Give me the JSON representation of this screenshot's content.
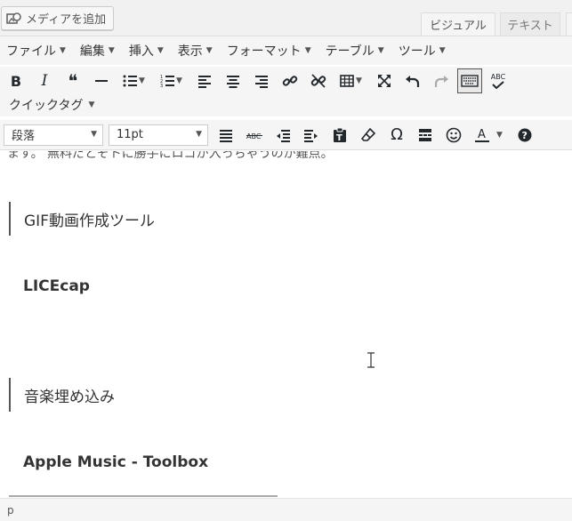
{
  "top": {
    "add_media_label": "メディアを追加",
    "tab_visual": "ビジュアル",
    "tab_text": "テキスト"
  },
  "menu": [
    {
      "label": "ファイル"
    },
    {
      "label": "編集"
    },
    {
      "label": "挿入"
    },
    {
      "label": "表示"
    },
    {
      "label": "フォーマット"
    },
    {
      "label": "テーブル"
    },
    {
      "label": "ツール"
    }
  ],
  "toolbar": {
    "bold": "B",
    "italic": "I",
    "quote": "❝",
    "quicktag": "クイックタグ",
    "format_select": "段落",
    "size_select": "11pt",
    "spellcheck_label": "ABC"
  },
  "content": {
    "cut_text": "ます。 無料だとそトに勝手にロゴが入っちゃうのが難点。",
    "heading1": "GIF動画作成ツール",
    "tool1": "LICEcap",
    "heading2": "音楽埋め込み",
    "tool2": "Apple Music - Toolbox"
  },
  "status": {
    "path": "p"
  }
}
